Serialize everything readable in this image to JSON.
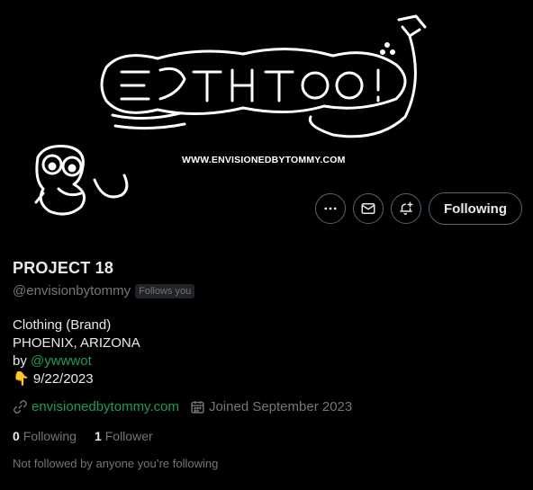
{
  "banner": {
    "url_text": "WWW.ENVISIONEDBYTOMMY.COM"
  },
  "actions": {
    "more_icon": "more-horizontal-icon",
    "message_icon": "envelope-icon",
    "notify_icon": "bell-plus-icon",
    "following_label": "Following"
  },
  "profile": {
    "name": "PROJECT 18",
    "handle": "@envisionbytommy",
    "follows_you": "Follows you",
    "bio_line1": "Clothing (Brand)",
    "bio_line2": "PHOENIX, ARIZONA",
    "bio_by": "by",
    "bio_mention": "@ywwwot",
    "bio_emoji": "👇",
    "bio_date": "9/22/2023",
    "website": "envisionedbytommy.com",
    "joined": "Joined September 2023"
  },
  "counts": {
    "following_count": "0",
    "following_label": "Following",
    "followers_count": "1",
    "followers_label": "Follower"
  },
  "mutual_text": "Not followed by anyone you’re following",
  "colors": {
    "background": "#000000",
    "link": "#1d9b56",
    "secondary_text": "#71767b",
    "border": "#536471"
  }
}
